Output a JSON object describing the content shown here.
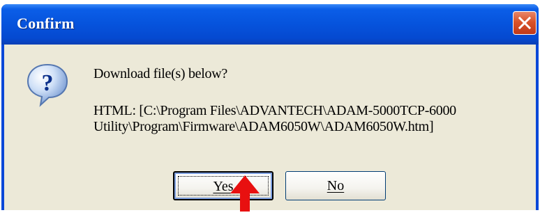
{
  "dialog": {
    "title": "Confirm",
    "icon": "question-icon",
    "prompt": "Download file(s) below?",
    "detail_line1": "HTML:  [C:\\Program Files\\ADVANTECH\\ADAM-5000TCP-6000",
    "detail_line2": "Utility\\Program\\Firmware\\ADAM6050W\\ADAM6050W.htm]",
    "buttons": {
      "yes_label": "Yes",
      "no_label": "No"
    }
  },
  "colors": {
    "titlebar": "#0653dc",
    "client_bg": "#ece9d8",
    "close_button": "#d9532a",
    "annotation_arrow": "#e81010"
  }
}
